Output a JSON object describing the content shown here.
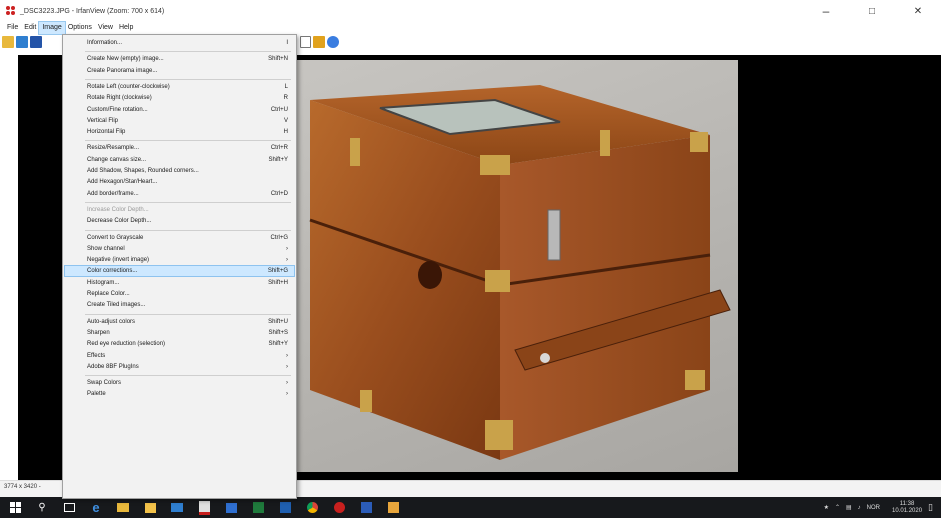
{
  "window": {
    "title": "_DSC3223.JPG - IrfanView (Zoom: 700 x 614)",
    "controls": {
      "minimize": "–",
      "maximize": "□",
      "close": "✕"
    }
  },
  "menubar": {
    "items": [
      {
        "label": "File"
      },
      {
        "label": "Edit"
      },
      {
        "label": "Image",
        "active": true
      },
      {
        "label": "Options"
      },
      {
        "label": "View"
      },
      {
        "label": "Help"
      }
    ]
  },
  "image_menu": {
    "items": [
      {
        "label": "Information...",
        "shortcut": "I"
      },
      {
        "sep": true
      },
      {
        "label": "Create New (empty) image...",
        "shortcut": "Shift+N"
      },
      {
        "label": "Create Panorama image..."
      },
      {
        "sep": true
      },
      {
        "label": "Rotate Left (counter-clockwise)",
        "shortcut": "L"
      },
      {
        "label": "Rotate Right (clockwise)",
        "shortcut": "R"
      },
      {
        "label": "Custom/Fine rotation...",
        "shortcut": "Ctrl+U"
      },
      {
        "label": "Vertical Flip",
        "shortcut": "V"
      },
      {
        "label": "Horizontal Flip",
        "shortcut": "H"
      },
      {
        "sep": true
      },
      {
        "label": "Resize/Resample...",
        "shortcut": "Ctrl+R"
      },
      {
        "label": "Change canvas size...",
        "shortcut": "Shift+Y"
      },
      {
        "label": "Add Shadow, Shapes, Rounded corners..."
      },
      {
        "label": "Add Hexagon/Star/Heart..."
      },
      {
        "label": "Add border/frame...",
        "shortcut": "Ctrl+D"
      },
      {
        "sep": true
      },
      {
        "label": "Increase Color Depth...",
        "disabled": true
      },
      {
        "label": "Decrease Color Depth..."
      },
      {
        "sep": true
      },
      {
        "label": "Convert to Grayscale",
        "shortcut": "Ctrl+G"
      },
      {
        "label": "Show channel",
        "shortcut": "›"
      },
      {
        "label": "Negative (invert image)",
        "shortcut": "›"
      },
      {
        "label": "Color corrections...",
        "shortcut": "Shift+G",
        "highlighted": true
      },
      {
        "label": "Histogram...",
        "shortcut": "Shift+H"
      },
      {
        "label": "Replace Color..."
      },
      {
        "label": "Create Tiled images..."
      },
      {
        "sep": true
      },
      {
        "label": "Auto-adjust colors",
        "shortcut": "Shift+U"
      },
      {
        "label": "Sharpen",
        "shortcut": "Shift+S"
      },
      {
        "label": "Red eye reduction (selection)",
        "shortcut": "Shift+Y"
      },
      {
        "label": "Effects",
        "shortcut": "›"
      },
      {
        "label": "Adobe 8BF PlugIns",
        "shortcut": "›"
      },
      {
        "sep": true
      },
      {
        "label": "Swap Colors",
        "shortcut": "›"
      },
      {
        "label": "Palette",
        "shortcut": "›"
      }
    ]
  },
  "statusbar": {
    "text": "3774 x 3420 -"
  },
  "taskbar": {
    "icons": [
      "windows-start-icon",
      "search-icon",
      "task-view-icon",
      "edge-icon",
      "file-explorer-icon",
      "store-icon",
      "mail-icon",
      "acrobat-icon",
      "photos-icon",
      "excel-icon",
      "outlook-icon",
      "chrome-icon",
      "irfanview-icon",
      "word-icon",
      "paint-icon"
    ],
    "tray": {
      "lang": "NOR",
      "time": "11:38",
      "date": "10.01.2020"
    }
  },
  "colors": {
    "menu_highlight": "#cde8ff",
    "taskbar": "#17191c",
    "canvas": "#000000",
    "wood": "#9a4e1e",
    "brass": "#c9a24a"
  }
}
